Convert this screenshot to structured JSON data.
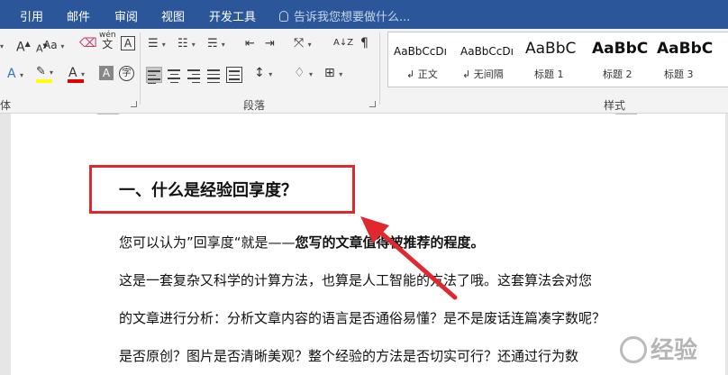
{
  "menu": {
    "tabs": [
      "引用",
      "邮件",
      "审阅",
      "视图",
      "开发工具"
    ],
    "tell_me": "告诉我您想要做什么..."
  },
  "ribbon": {
    "font_group_label": "体",
    "paragraph_group_label": "段落",
    "styles_group_label": "样式",
    "styles": [
      {
        "sample": "AaBbCcDı",
        "name": "正文"
      },
      {
        "sample": "AaBbCcDı",
        "name": "无间隔"
      },
      {
        "sample": "AaBbC",
        "name": "标题 1"
      },
      {
        "sample": "AaBbC",
        "name": "标题 2"
      },
      {
        "sample": "AaBbC",
        "name": "标题 3"
      }
    ],
    "font_glyph_a": "A",
    "font_aa": "Aa",
    "wen": "wén",
    "wen_char": "文",
    "char_border": "A",
    "char_shade": "A",
    "enclose": "字",
    "sort": "A↓Z"
  },
  "document": {
    "heading": "一、什么是经验回享度？",
    "p1_plain": "您可以认为”回享度“就是——",
    "p1_bold": "您写的文章值得被推荐的程度。",
    "p2": "这是一套复杂又科学的计算方法，也算是人工智能的方法了哦。这套算法会对您",
    "p3": "的文章进行分析：分析文章内容的语言是否通俗易懂？是不是废话连篇凑字数呢？",
    "p4": "是否原创？图片是否清晰美观？整个经验的方法是否切实可行？还通过行为数"
  },
  "watermark": {
    "text": "经验"
  },
  "colors": {
    "menu_bg": "#2b579a",
    "highlight": "#e0282e",
    "font_color_bar": "#e00000",
    "highlighter_bar": "#ffff00"
  }
}
